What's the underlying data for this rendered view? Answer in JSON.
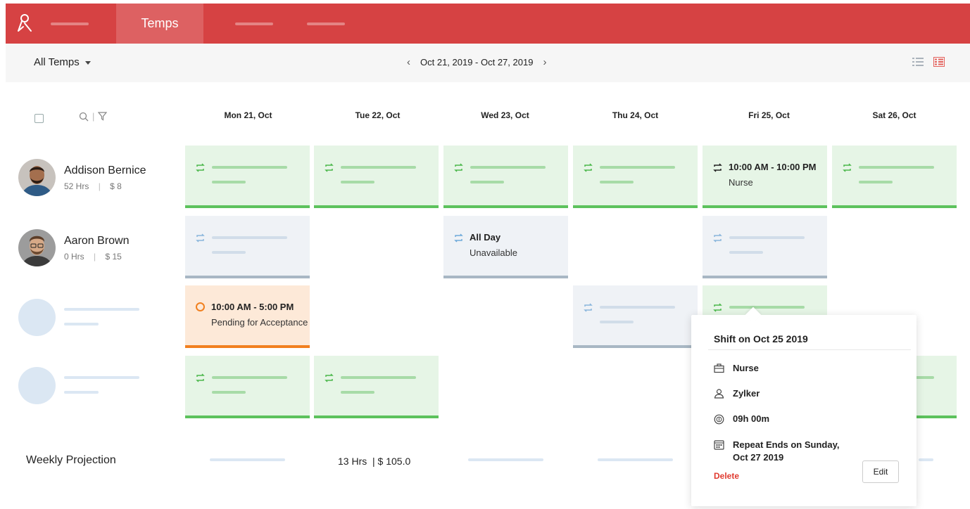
{
  "nav": {
    "active_tab": "Temps"
  },
  "toolbar": {
    "filter_label": "All Temps",
    "date_range": "Oct 21, 2019 - Oct 27, 2019",
    "prev_icon": "chevron-left-icon",
    "next_icon": "chevron-right-icon"
  },
  "days": [
    "Mon 21, Oct",
    "Tue 22, Oct",
    "Wed 23, Oct",
    "Thu 24, Oct",
    "Fri 25, Oct",
    "Sat 26, Oct"
  ],
  "people": [
    {
      "name": "Addison Bernice",
      "hours": "52 Hrs",
      "rate": "$ 8"
    },
    {
      "name": "Aaron Brown",
      "hours": "0 Hrs",
      "rate": "$ 15"
    }
  ],
  "shifts": {
    "addison_fri": {
      "time": "10:00 AM - 10:00 PM",
      "role": "Nurse"
    },
    "aaron_wed": {
      "time": "All Day",
      "status": "Unavailable"
    },
    "row3_mon": {
      "time": "10:00 AM - 5:00 PM",
      "status": "Pending for Acceptance"
    }
  },
  "projection": {
    "label": "Weekly Projection",
    "value": "13 Hrs  | $ 105.0"
  },
  "popover": {
    "title": "Shift on Oct 25 2019",
    "role": "Nurse",
    "client": "Zylker",
    "duration": "09h 00m",
    "repeat_line1": "Repeat Ends on Sunday,",
    "repeat_line2": "Oct 27 2019",
    "delete_label": "Delete",
    "edit_label": "Edit"
  },
  "colors": {
    "brand": "#d64243",
    "shift_green": "#5cc25c",
    "unavailable_grey": "#a8b7c4",
    "pending_orange": "#f1801f"
  }
}
